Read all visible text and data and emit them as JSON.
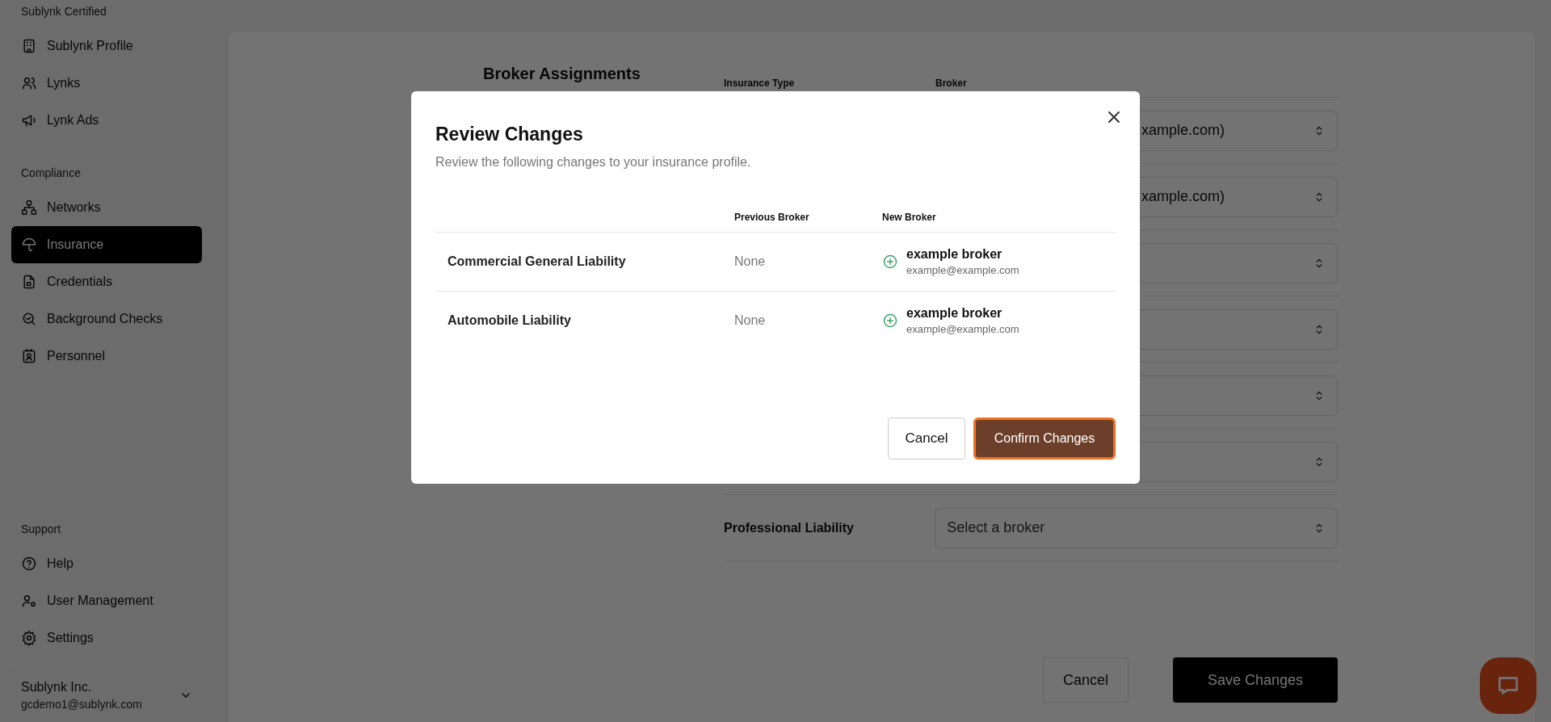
{
  "sidebar": {
    "sections": [
      {
        "heading": "Sublynk Certified",
        "items": [
          {
            "label": "Sublynk Profile",
            "selected": false
          },
          {
            "label": "Lynks",
            "selected": false
          },
          {
            "label": "Lynk Ads",
            "selected": false
          }
        ]
      },
      {
        "heading": "Compliance",
        "items": [
          {
            "label": "Networks",
            "selected": false
          },
          {
            "label": "Insurance",
            "selected": true
          },
          {
            "label": "Credentials",
            "selected": false
          },
          {
            "label": "Background Checks",
            "selected": false
          },
          {
            "label": "Personnel",
            "selected": false
          }
        ]
      },
      {
        "heading": "Support",
        "items": [
          {
            "label": "Help",
            "selected": false
          },
          {
            "label": "User Management",
            "selected": false
          },
          {
            "label": "Settings",
            "selected": false
          }
        ]
      }
    ],
    "account": {
      "name": "Sublynk Inc.",
      "email": "gcdemo1@sublynk.com"
    }
  },
  "main": {
    "title": "Broker Assignments",
    "columns": [
      "Insurance Type",
      "Broker"
    ],
    "rows": [
      {
        "kind": "partial",
        "value": "xample.com)"
      },
      {
        "kind": "partial",
        "value": "xample.com)"
      },
      {
        "kind": "covered"
      },
      {
        "kind": "covered"
      },
      {
        "kind": "covered"
      },
      {
        "kind": "covered"
      },
      {
        "kind": "full",
        "label": "Professional Liability",
        "placeholder": "Select a broker"
      }
    ],
    "buttons": {
      "cancel": "Cancel",
      "save": "Save Changes"
    }
  },
  "dialog": {
    "title": "Review Changes",
    "description": "Review the following changes to your insurance profile.",
    "columns": [
      "Previous Broker",
      "New Broker"
    ],
    "rows": [
      {
        "type": "Commercial General Liability",
        "previous": "None",
        "new_name": "example broker",
        "new_email": "example@example.com"
      },
      {
        "type": "Automobile Liability",
        "previous": "None",
        "new_name": "example broker",
        "new_email": "example@example.com"
      }
    ],
    "buttons": {
      "cancel": "Cancel",
      "confirm": "Confirm Changes"
    }
  }
}
